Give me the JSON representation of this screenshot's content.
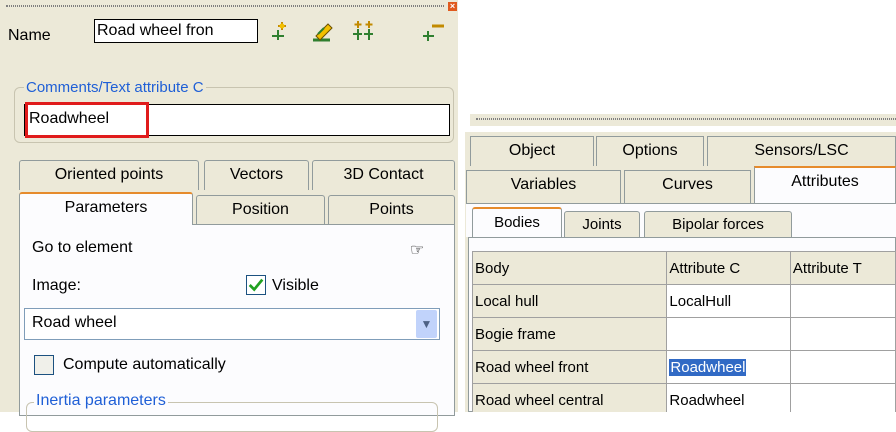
{
  "left_panel": {
    "name_label": "Name",
    "name_value": "Road wheel fron",
    "comments_legend": "Comments/Text attribute C",
    "comments_value": "Roadwheel",
    "tabs_row1": [
      "Oriented points",
      "Vectors",
      "3D Contact"
    ],
    "tabs_row2": [
      "Parameters",
      "Position",
      "Points"
    ],
    "goto_label": "Go to element",
    "image_label": "Image:",
    "visible_label": "Visible",
    "visible_checked": true,
    "image_select_value": "Road wheel",
    "compute_label": "Compute automatically",
    "compute_checked": false,
    "inertia_legend": "Inertia parameters"
  },
  "icons": [
    "drag-grip-icon",
    "close-icon",
    "add-point-icon",
    "edit-point-icon",
    "merge-points-icon",
    "remove-point-icon",
    "pointing-hand-icon",
    "check-icon",
    "chevron-down-icon"
  ],
  "right_panel": {
    "tabs_row1": [
      "Object",
      "Options",
      "Sensors/LSC"
    ],
    "tabs_row2": [
      "Variables",
      "Curves",
      "Attributes"
    ],
    "subtabs": [
      "Bodies",
      "Joints",
      "Bipolar forces"
    ],
    "grid": {
      "headers": [
        "Body",
        "Attribute C",
        "Attribute T"
      ],
      "rows": [
        [
          "Local hull",
          "LocalHull",
          ""
        ],
        [
          "Bogie frame",
          "",
          ""
        ],
        [
          "Road wheel front",
          "Roadwheel",
          ""
        ],
        [
          "Road wheel central",
          "Roadwheel",
          ""
        ]
      ]
    }
  },
  "colors": {
    "panel_bg": "#ece9d8",
    "tab_active_accent": "#e68b2c",
    "legend_blue": "#1f5fd6",
    "highlight_red": "#e01b1b",
    "selection_blue": "#316ac5"
  }
}
